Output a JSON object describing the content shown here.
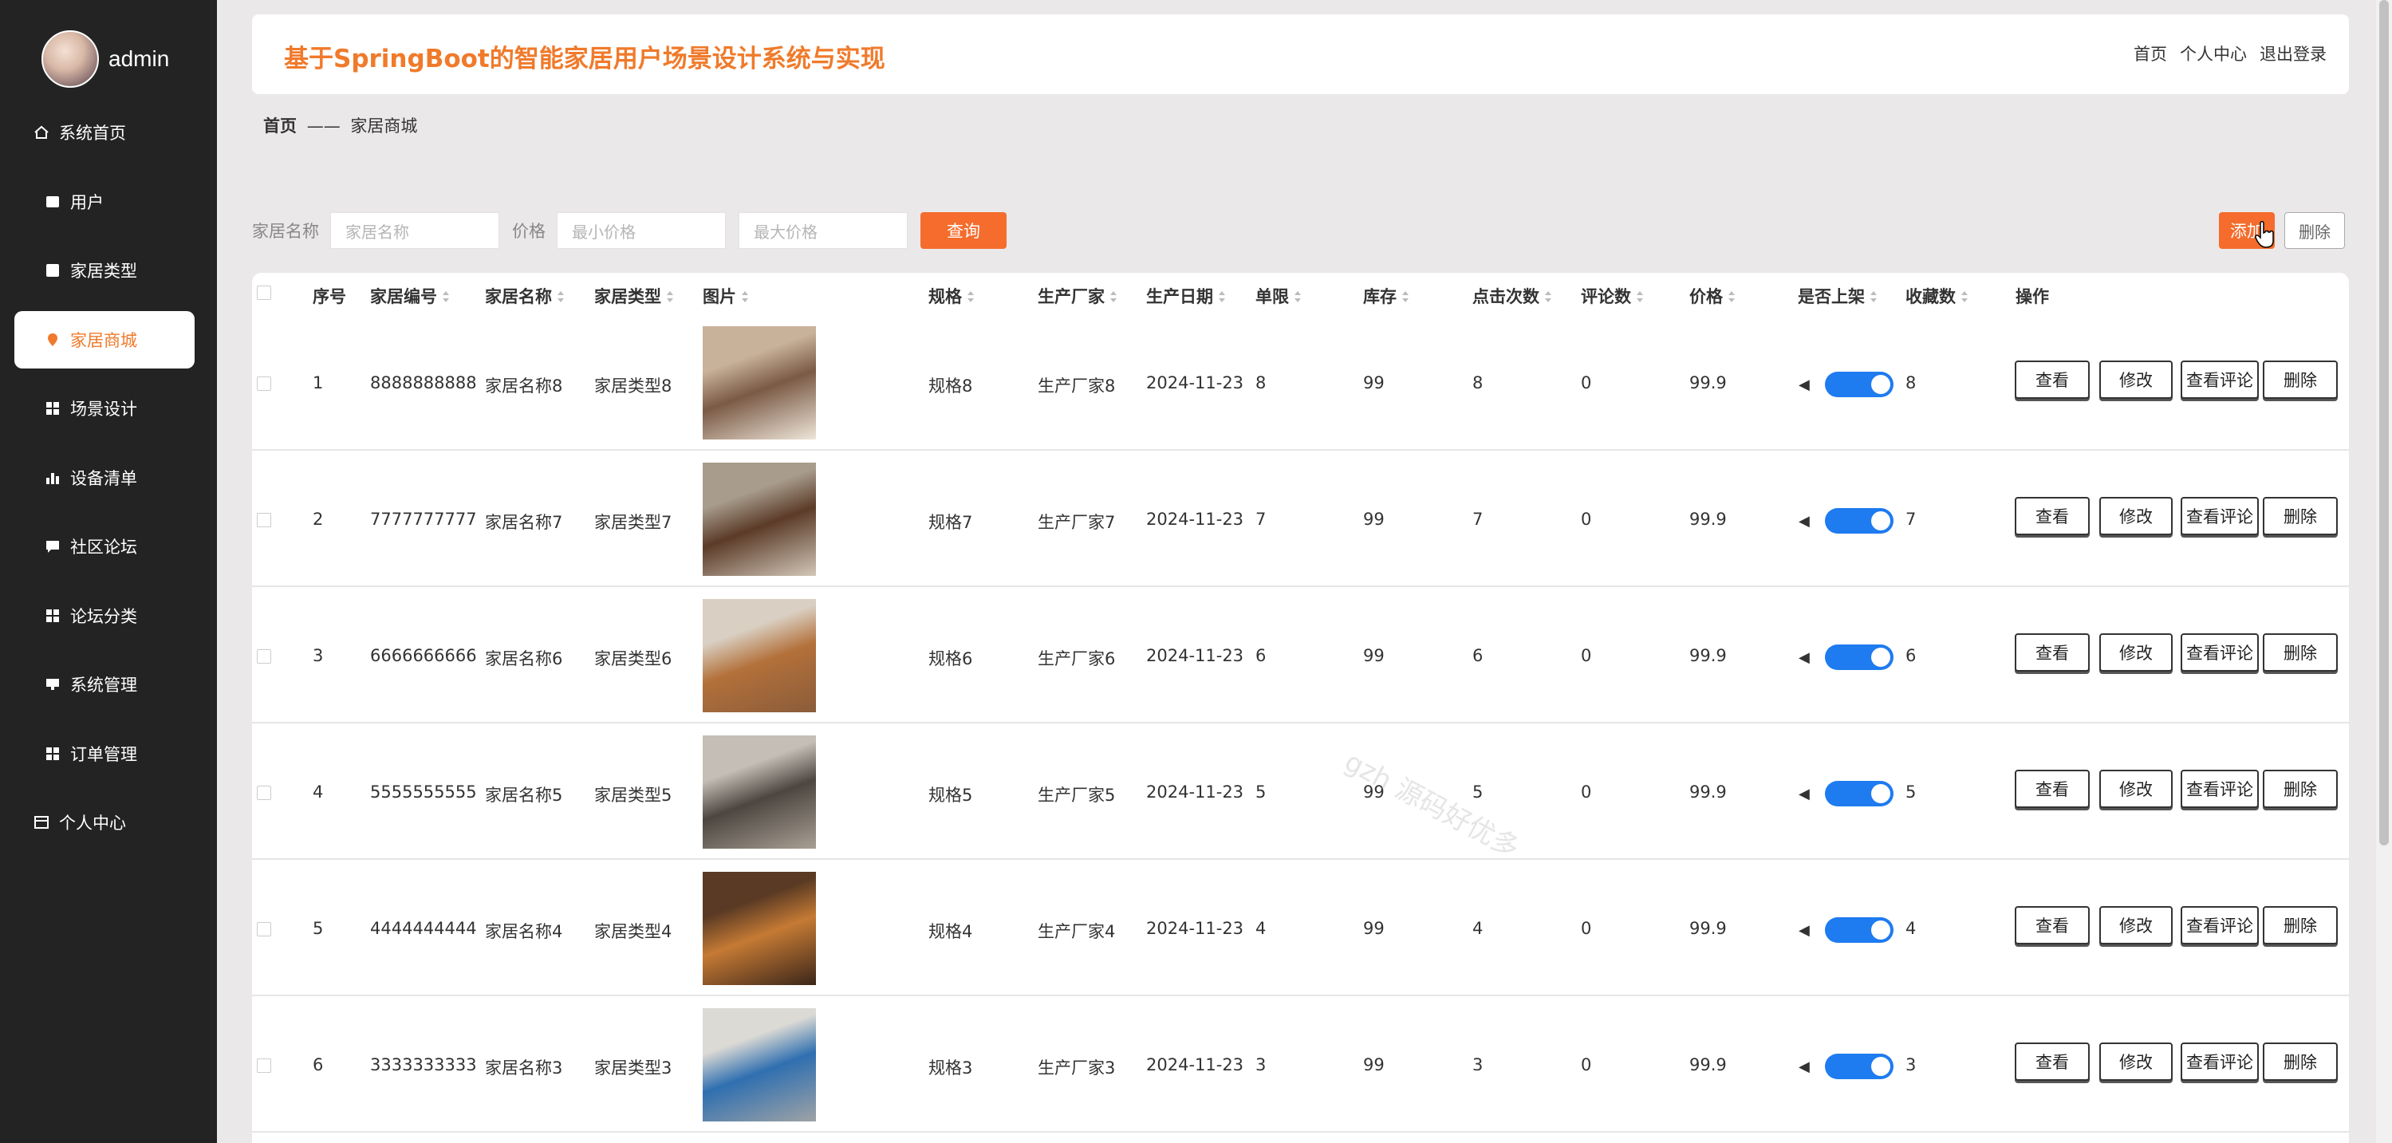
{
  "sidebar": {
    "user": "admin",
    "items": [
      {
        "label": "系统首页",
        "icon": "home-icon"
      },
      {
        "label": "用户",
        "icon": "square-icon"
      },
      {
        "label": "家居类型",
        "icon": "square-icon"
      },
      {
        "label": "家居商城",
        "icon": "pin-icon"
      },
      {
        "label": "场景设计",
        "icon": "grid-icon"
      },
      {
        "label": "设备清单",
        "icon": "bar-chart-icon"
      },
      {
        "label": "社区论坛",
        "icon": "comment-icon"
      },
      {
        "label": "论坛分类",
        "icon": "grid-icon"
      },
      {
        "label": "系统管理",
        "icon": "square-icon"
      },
      {
        "label": "订单管理",
        "icon": "grid-icon"
      },
      {
        "label": "个人中心",
        "icon": "calendar-icon"
      }
    ]
  },
  "header": {
    "title": "基于SpringBoot的智能家居用户场景设计系统与实现",
    "links": [
      "首页",
      "个人中心",
      "退出登录"
    ]
  },
  "breadcrumb": {
    "home": "首页",
    "sep": "——",
    "current": "家居商城"
  },
  "search": {
    "name_label": "家居名称",
    "name_placeholder": "家居名称",
    "price_label": "价格",
    "min_placeholder": "最小价格",
    "max_placeholder": "最大价格",
    "query_button": "查询",
    "add_button": "添加",
    "delete_button": "删除"
  },
  "table": {
    "headers": [
      "序号",
      "家居编号",
      "家居名称",
      "家居类型",
      "图片",
      "规格",
      "生产厂家",
      "生产日期",
      "单限",
      "库存",
      "点击次数",
      "评论数",
      "价格",
      "是否上架",
      "收藏数",
      "操作"
    ],
    "actions": [
      "查看",
      "修改",
      "查看评论",
      "删除"
    ],
    "rows": [
      {
        "idx": "1",
        "code": "8888888888",
        "name": "家居名称8",
        "type": "家居类型8",
        "spec": "规格8",
        "maker": "生产厂家8",
        "date": "2024-11-23",
        "limit": "8",
        "stock": "99",
        "clicks": "8",
        "comments": "0",
        "price": "99.9",
        "favs": "8"
      },
      {
        "idx": "2",
        "code": "7777777777",
        "name": "家居名称7",
        "type": "家居类型7",
        "spec": "规格7",
        "maker": "生产厂家7",
        "date": "2024-11-23",
        "limit": "7",
        "stock": "99",
        "clicks": "7",
        "comments": "0",
        "price": "99.9",
        "favs": "7"
      },
      {
        "idx": "3",
        "code": "6666666666",
        "name": "家居名称6",
        "type": "家居类型6",
        "spec": "规格6",
        "maker": "生产厂家6",
        "date": "2024-11-23",
        "limit": "6",
        "stock": "99",
        "clicks": "6",
        "comments": "0",
        "price": "99.9",
        "favs": "6"
      },
      {
        "idx": "4",
        "code": "5555555555",
        "name": "家居名称5",
        "type": "家居类型5",
        "spec": "规格5",
        "maker": "生产厂家5",
        "date": "2024-11-23",
        "limit": "5",
        "stock": "99",
        "clicks": "5",
        "comments": "0",
        "price": "99.9",
        "favs": "5"
      },
      {
        "idx": "5",
        "code": "4444444444",
        "name": "家居名称4",
        "type": "家居类型4",
        "spec": "规格4",
        "maker": "生产厂家4",
        "date": "2024-11-23",
        "limit": "4",
        "stock": "99",
        "clicks": "4",
        "comments": "0",
        "price": "99.9",
        "favs": "4"
      },
      {
        "idx": "6",
        "code": "3333333333",
        "name": "家居名称3",
        "type": "家居类型3",
        "spec": "规格3",
        "maker": "生产厂家3",
        "date": "2024-11-23",
        "limit": "3",
        "stock": "99",
        "clicks": "3",
        "comments": "0",
        "price": "99.9",
        "favs": "3"
      }
    ]
  },
  "watermark": "gzh 源码好优多",
  "colors": {
    "accent": "#f07a2b",
    "sidebar": "#232323",
    "toggle": "#1e7bf0"
  }
}
